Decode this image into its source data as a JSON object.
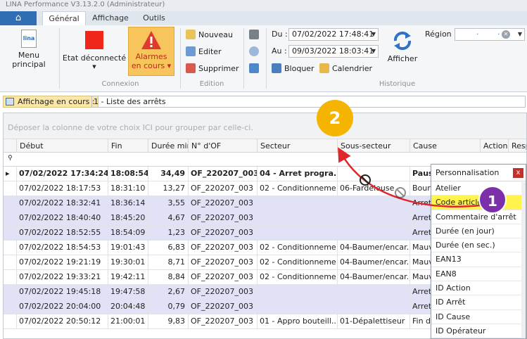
{
  "window": {
    "title": "LINA Performance  V3.13.2.0  (Administrateur)"
  },
  "tabs": [
    {
      "label": "Général"
    },
    {
      "label": "Affichage"
    },
    {
      "label": "Outils"
    }
  ],
  "ribbon": {
    "menu_principal": "Menu principal",
    "etat_line1": "Etat déconnecté",
    "alarmes_line1": "Alarmes",
    "alarmes_line2": "en cours",
    "connexion_label": "Connexion",
    "nouveau": "Nouveau",
    "editer": "Editer",
    "supprimer": "Supprimer",
    "edition_label": "Edition",
    "du_label": "Du :",
    "du_value": "07/02/2022 17:48:41",
    "au_label": "Au :",
    "au_value": "09/03/2022 18:03:41",
    "bloquer": "Bloquer",
    "calendrier": "Calendrier",
    "afficher": "Afficher",
    "region_label": "Région :",
    "historique_label": "Historique"
  },
  "affichage": {
    "label": "Affichage en cours :",
    "value": "1 - Liste des arrêts"
  },
  "grid": {
    "group_hint": "Déposer la colonne de votre choix ICI pour grouper par celle-ci.",
    "columns": [
      "Début",
      "Fin",
      "Durée min",
      "N° d'OF",
      "Secteur",
      "Sous-secteur",
      "Cause",
      "Action",
      "Resp"
    ],
    "rows": [
      {
        "debut": "07/02/2022 17:34:24",
        "fin": "18:08:54",
        "duree": "34,49",
        "of": "OF_220207_003",
        "secteur": "04 - Arret progra...",
        "sous": "",
        "cause": "Paus"
      },
      {
        "debut": "07/02/2022 18:17:53",
        "fin": "18:31:10",
        "duree": "13,27",
        "of": "OF_220207_003",
        "secteur": "02 - Conditionneme",
        "sous": "06-Fardeleuse",
        "cause": "Bourra"
      },
      {
        "debut": "07/02/2022 18:32:41",
        "fin": "18:36:14",
        "duree": "3,55",
        "of": "OF_220207_003",
        "secteur": "",
        "sous": "",
        "cause": "Arret"
      },
      {
        "debut": "07/02/2022 18:40:40",
        "fin": "18:45:20",
        "duree": "4,67",
        "of": "OF_220207_003",
        "secteur": "",
        "sous": "",
        "cause": "Arret"
      },
      {
        "debut": "07/02/2022 18:52:55",
        "fin": "18:54:09",
        "duree": "1,23",
        "of": "OF_220207_003",
        "secteur": "",
        "sous": "",
        "cause": "Arret"
      },
      {
        "debut": "07/02/2022 18:54:53",
        "fin": "19:01:43",
        "duree": "6,83",
        "of": "OF_220207_003",
        "secteur": "02 - Conditionneme",
        "sous": "04-Baumer/encar...",
        "cause": "Mauva"
      },
      {
        "debut": "07/02/2022 19:21:19",
        "fin": "19:30:01",
        "duree": "8,71",
        "of": "OF_220207_003",
        "secteur": "02 - Conditionneme",
        "sous": "04-Baumer/encar...",
        "cause": "Mauva"
      },
      {
        "debut": "07/02/2022 19:33:21",
        "fin": "19:42:11",
        "duree": "8,84",
        "of": "OF_220207_003",
        "secteur": "02 - Conditionneme",
        "sous": "04-Baumer/encar...",
        "cause": "Mauva"
      },
      {
        "debut": "07/02/2022 19:45:18",
        "fin": "19:47:58",
        "duree": "2,67",
        "of": "OF_220207_003",
        "secteur": "",
        "sous": "",
        "cause": "Arret"
      },
      {
        "debut": "07/02/2022 20:04:00",
        "fin": "20:04:48",
        "duree": "0,79",
        "of": "OF_220207_003",
        "secteur": "",
        "sous": "",
        "cause": "Arret"
      },
      {
        "debut": "07/02/2022 20:50:12",
        "fin": "21:00:01",
        "duree": "9,83",
        "of": "OF_220207_003",
        "secteur": "01 - Appro bouteill...",
        "sous": "01-Dépalettiseur",
        "cause": "Fin de"
      }
    ]
  },
  "personnalisation": {
    "title": "Personnalisation",
    "close": "x",
    "items": [
      "Atelier",
      "Code article",
      "Commentaire d'arrêt",
      "Durée (en jour)",
      "Durée (en sec.)",
      "EAN13",
      "EAN8",
      "ID Action",
      "ID Arrêt",
      "ID Cause",
      "ID Opérateur"
    ]
  },
  "annotations": {
    "badge1": "1",
    "badge2": "2"
  },
  "colors": {
    "accent": "#2f6db5",
    "alarm": "#f2bf4a",
    "row_alt": "#e2e2f7",
    "highlight": "#fff44d",
    "arrow": "#e0262b",
    "badge1": "#7b2fa8",
    "badge2": "#f4b400"
  }
}
